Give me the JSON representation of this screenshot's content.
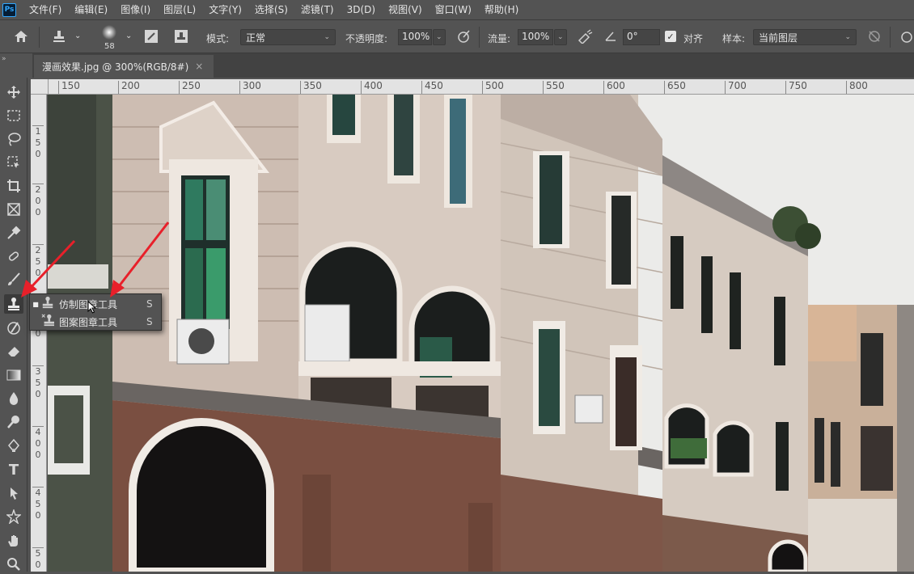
{
  "app": {
    "logo": "Ps"
  },
  "menu": [
    "文件(F)",
    "编辑(E)",
    "图像(I)",
    "图层(L)",
    "文字(Y)",
    "选择(S)",
    "滤镜(T)",
    "3D(D)",
    "视图(V)",
    "窗口(W)",
    "帮助(H)"
  ],
  "options": {
    "brush_size": "58",
    "mode_label": "模式:",
    "mode_value": "正常",
    "opacity_label": "不透明度:",
    "opacity_value": "100%",
    "flow_label": "流量:",
    "flow_value": "100%",
    "angle_value": "0°",
    "aligned_label": "对齐",
    "aligned_checked": true,
    "sample_label": "样本:",
    "sample_value": "当前图层"
  },
  "document": {
    "tab_title": "漫画效果.jpg @ 300%(RGB/8#)",
    "close_glyph": "×"
  },
  "rulers": {
    "horizontal": [
      "150",
      "200",
      "250",
      "300",
      "350",
      "400",
      "450",
      "500",
      "550",
      "600",
      "650",
      "700",
      "750",
      "800"
    ],
    "vertical": [
      "150",
      "200",
      "250",
      "300",
      "350",
      "400",
      "450",
      "500"
    ]
  },
  "toolbar": {
    "collapse_glyph": "»",
    "tools": [
      "move-icon",
      "marquee-icon",
      "lasso-icon",
      "object-select-icon",
      "crop-icon",
      "frame-icon",
      "eyedropper-icon",
      "healing-icon",
      "brush-icon",
      "stamp-icon",
      "history-brush-icon",
      "eraser-icon",
      "gradient-icon",
      "blur-icon",
      "dodge-icon",
      "pen-icon",
      "type-icon",
      "path-select-icon",
      "shape-icon",
      "hand-icon",
      "zoom-icon"
    ],
    "type_glyph": "T"
  },
  "flyout": {
    "items": [
      {
        "label": "仿制图章工具",
        "shortcut": "S",
        "selected": true
      },
      {
        "label": "图案图章工具",
        "shortcut": "S",
        "selected": false
      }
    ]
  },
  "colors": {
    "annotation_arrow": "#e8202a",
    "ui_panel": "#535353",
    "ruler": "#e3e3e3"
  }
}
